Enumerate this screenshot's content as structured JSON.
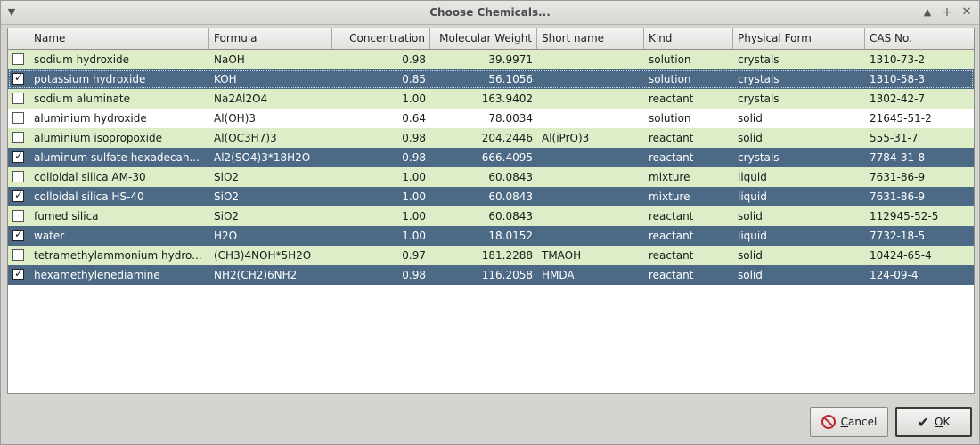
{
  "window": {
    "title": "Choose Chemicals...",
    "menu_icon": "chevron-down-icon",
    "controls": [
      "up-arrow-icon",
      "maximize-plus-icon",
      "close-x-icon"
    ]
  },
  "table": {
    "columns": [
      "",
      "Name",
      "Formula",
      "Concentration",
      "Molecular Weight",
      "Short name",
      "Kind",
      "Physical Form",
      "CAS No."
    ],
    "rows": [
      {
        "checked": false,
        "selected": false,
        "name": "sodium hydroxide",
        "formula": "NaOH",
        "concentration": "0.98",
        "mw": "39.9971",
        "short": "",
        "kind": "solution",
        "form": "crystals",
        "cas": "1310-73-2"
      },
      {
        "checked": true,
        "selected": true,
        "focused": true,
        "name": "potassium hydroxide",
        "formula": "KOH",
        "concentration": "0.85",
        "mw": "56.1056",
        "short": "",
        "kind": "solution",
        "form": "crystals",
        "cas": "1310-58-3"
      },
      {
        "checked": false,
        "selected": false,
        "name": "sodium aluminate",
        "formula": "Na2Al2O4",
        "concentration": "1.00",
        "mw": "163.9402",
        "short": "",
        "kind": "reactant",
        "form": "crystals",
        "cas": "1302-42-7"
      },
      {
        "checked": false,
        "selected": false,
        "name": "aluminium hydroxide",
        "formula": "Al(OH)3",
        "concentration": "0.64",
        "mw": "78.0034",
        "short": "",
        "kind": "solution",
        "form": "solid",
        "cas": "21645-51-2"
      },
      {
        "checked": false,
        "selected": false,
        "name": "aluminium isopropoxide",
        "formula": "Al(OC3H7)3",
        "concentration": "0.98",
        "mw": "204.2446",
        "short": "Al(iPrO)3",
        "kind": "reactant",
        "form": "solid",
        "cas": "555-31-7"
      },
      {
        "checked": true,
        "selected": true,
        "name": "aluminum sulfate hexadecah...",
        "formula": "Al2(SO4)3*18H2O",
        "concentration": "0.98",
        "mw": "666.4095",
        "short": "",
        "kind": "reactant",
        "form": "crystals",
        "cas": "7784-31-8"
      },
      {
        "checked": false,
        "selected": false,
        "name": "colloidal silica AM-30",
        "formula": "SiO2",
        "concentration": "1.00",
        "mw": "60.0843",
        "short": "",
        "kind": "mixture",
        "form": "liquid",
        "cas": "7631-86-9"
      },
      {
        "checked": true,
        "selected": true,
        "name": "colloidal silica HS-40",
        "formula": "SiO2",
        "concentration": "1.00",
        "mw": "60.0843",
        "short": "",
        "kind": "mixture",
        "form": "liquid",
        "cas": "7631-86-9"
      },
      {
        "checked": false,
        "selected": false,
        "name": "fumed silica",
        "formula": "SiO2",
        "concentration": "1.00",
        "mw": "60.0843",
        "short": "",
        "kind": "reactant",
        "form": "solid",
        "cas": "112945-52-5"
      },
      {
        "checked": true,
        "selected": true,
        "name": "water",
        "formula": "H2O",
        "concentration": "1.00",
        "mw": "18.0152",
        "short": "",
        "kind": "reactant",
        "form": "liquid",
        "cas": "7732-18-5"
      },
      {
        "checked": false,
        "selected": false,
        "name": "tetramethylammonium hydro...",
        "formula": "(CH3)4NOH*5H2O",
        "concentration": "0.97",
        "mw": "181.2288",
        "short": "TMAOH",
        "kind": "reactant",
        "form": "solid",
        "cas": "10424-65-4"
      },
      {
        "checked": true,
        "selected": true,
        "name": "hexamethylenediamine",
        "formula": "NH2(CH2)6NH2",
        "concentration": "0.98",
        "mw": "116.2058",
        "short": "HMDA",
        "kind": "reactant",
        "form": "solid",
        "cas": "124-09-4"
      }
    ]
  },
  "buttons": {
    "cancel_label": "Cancel",
    "cancel_underline": "C",
    "cancel_rest": "ancel",
    "cancel_icon": "cancel-circle-icon",
    "ok_label": "OK",
    "ok_underline": "O",
    "ok_rest": "K",
    "ok_icon": "checkmark-icon"
  },
  "colors": {
    "row_stripe": "#dcedc8",
    "row_selected": "#4c6a85",
    "background": "#d6d4d1"
  }
}
